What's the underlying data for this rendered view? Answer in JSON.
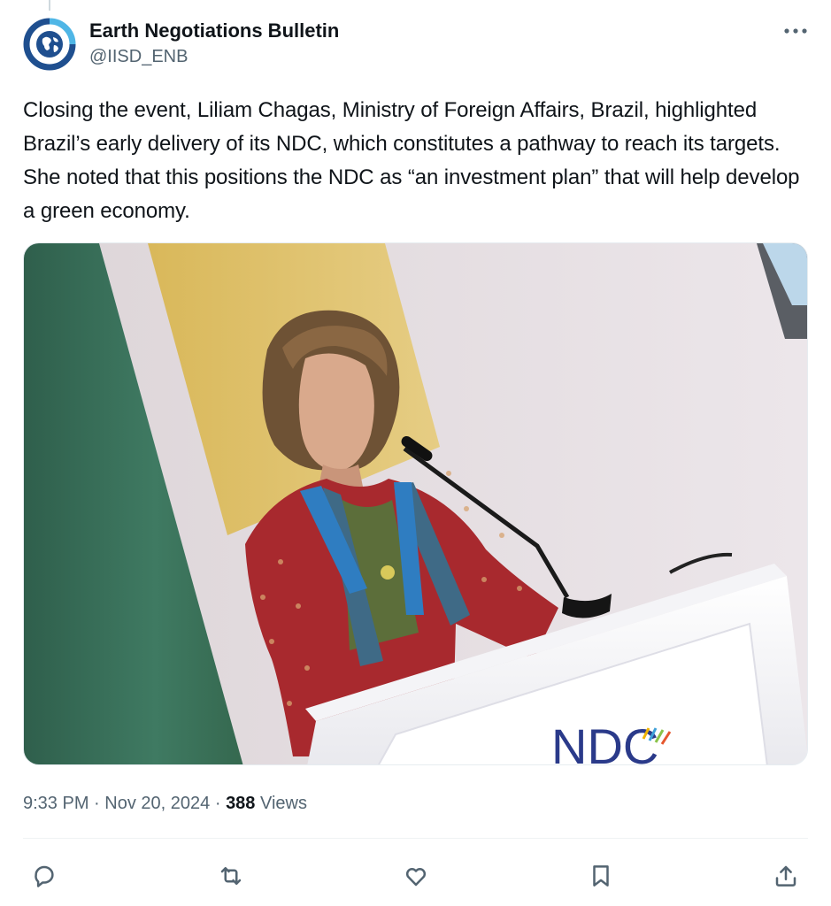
{
  "account": {
    "display_name": "Earth Negotiations Bulletin",
    "handle": "@IISD_ENB"
  },
  "tweet": {
    "text": "Closing the event, Liliam Chagas, Ministry of Foreign Affairs, Brazil, highlighted Brazil’s early delivery of its NDC, which constitutes a pathway to reach its targets. She noted that this positions the NDC as “an investment plan” that will help develop a green economy.",
    "photo_sign_text": "NDC",
    "time": "9:33 PM",
    "separator": "·",
    "date": "Nov 20, 2024",
    "views_count": "388",
    "views_label": "Views"
  },
  "actions": [
    {
      "name": "reply",
      "icon": "speech-bubble-icon"
    },
    {
      "name": "repost",
      "icon": "repost-arrows-icon"
    },
    {
      "name": "like",
      "icon": "heart-icon"
    },
    {
      "name": "bookmark",
      "icon": "bookmark-icon"
    },
    {
      "name": "share",
      "icon": "share-upload-icon"
    }
  ],
  "colors": {
    "text_primary": "#0f1419",
    "text_secondary": "#536471",
    "avatar_blue": "#1f4f8f",
    "avatar_cyan": "#4fb6e6"
  }
}
